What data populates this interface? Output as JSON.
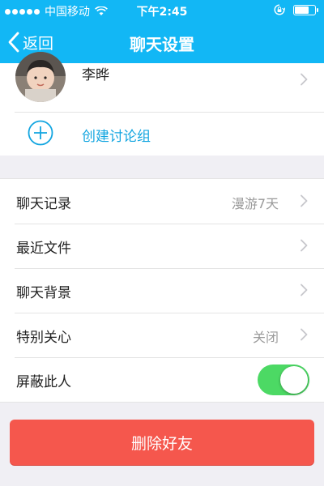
{
  "status_bar": {
    "carrier": "中国移动",
    "time": "下午2:45",
    "icons": [
      "signal-dots-icon",
      "wifi-icon",
      "rotation-lock-icon",
      "battery-icon"
    ],
    "battery_level": 0.75
  },
  "nav": {
    "back_label": "返回",
    "title": "聊天设置"
  },
  "profile": {
    "name": "李晔",
    "create_group_label": "创建讨论组"
  },
  "settings": [
    {
      "label": "聊天记录",
      "value": "漫游7天",
      "has_chevron": true
    },
    {
      "label": "最近文件",
      "value": "",
      "has_chevron": true
    },
    {
      "label": "聊天背景",
      "value": "",
      "has_chevron": true
    },
    {
      "label": "特别关心",
      "value": "关闭",
      "has_chevron": true
    },
    {
      "label": "屏蔽此人",
      "toggle_on": true
    }
  ],
  "delete_button_label": "删除好友",
  "colors": {
    "accent": "#12b7f5",
    "link": "#12a5e0",
    "danger": "#f5574d",
    "toggle_on": "#4cd964",
    "page_bg": "#f0eff4"
  }
}
